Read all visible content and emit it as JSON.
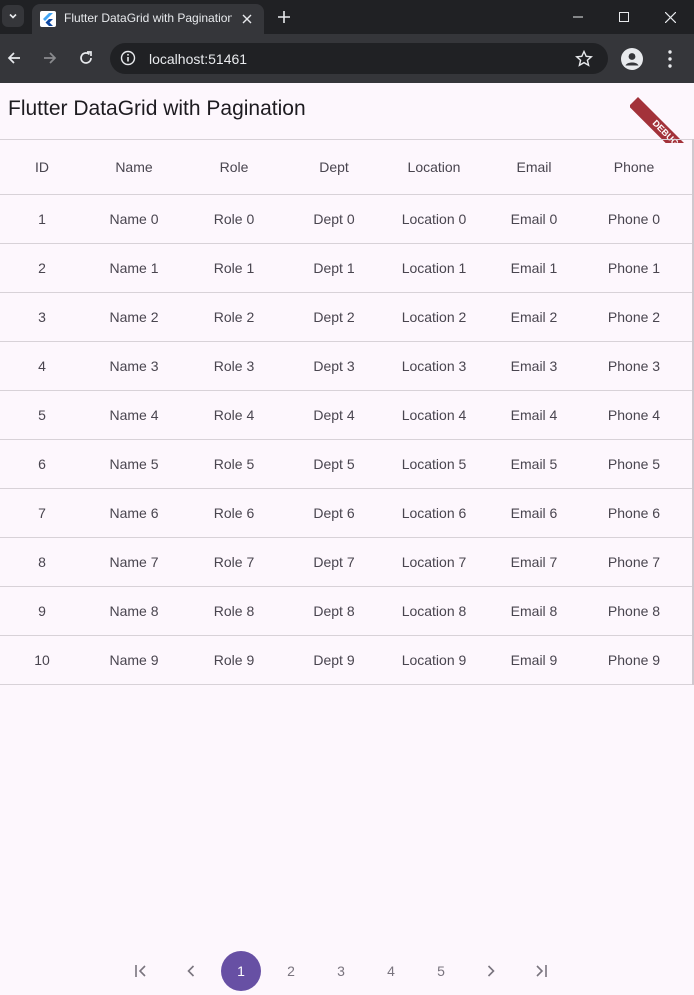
{
  "browser": {
    "tab_title": "Flutter DataGrid with Pagination",
    "url": "localhost:51461"
  },
  "app": {
    "title": "Flutter DataGrid with Pagination",
    "debug_banner": "DEBUG"
  },
  "grid": {
    "columns": [
      "ID",
      "Name",
      "Role",
      "Dept",
      "Location",
      "Email",
      "Phone"
    ],
    "rows": [
      [
        "1",
        "Name 0",
        "Role 0",
        "Dept 0",
        "Location 0",
        "Email 0",
        "Phone 0"
      ],
      [
        "2",
        "Name 1",
        "Role 1",
        "Dept 1",
        "Location 1",
        "Email 1",
        "Phone 1"
      ],
      [
        "3",
        "Name 2",
        "Role 2",
        "Dept 2",
        "Location 2",
        "Email 2",
        "Phone 2"
      ],
      [
        "4",
        "Name 3",
        "Role 3",
        "Dept 3",
        "Location 3",
        "Email 3",
        "Phone 3"
      ],
      [
        "5",
        "Name 4",
        "Role 4",
        "Dept 4",
        "Location 4",
        "Email 4",
        "Phone 4"
      ],
      [
        "6",
        "Name 5",
        "Role 5",
        "Dept 5",
        "Location 5",
        "Email 5",
        "Phone 5"
      ],
      [
        "7",
        "Name 6",
        "Role 6",
        "Dept 6",
        "Location 6",
        "Email 6",
        "Phone 6"
      ],
      [
        "8",
        "Name 7",
        "Role 7",
        "Dept 7",
        "Location 7",
        "Email 7",
        "Phone 7"
      ],
      [
        "9",
        "Name 8",
        "Role 8",
        "Dept 8",
        "Location 8",
        "Email 8",
        "Phone 8"
      ],
      [
        "10",
        "Name 9",
        "Role 9",
        "Dept 9",
        "Location 9",
        "Email 9",
        "Phone 9"
      ]
    ]
  },
  "pager": {
    "pages": [
      "1",
      "2",
      "3",
      "4",
      "5"
    ],
    "current_page": "1",
    "icons": [
      "first-page-icon",
      "previous-page-icon",
      "next-page-icon",
      "last-page-icon"
    ]
  },
  "colors": {
    "accent": "#6750a4",
    "background": "#fdf7fd",
    "debug_ribbon": "#a3323a"
  }
}
